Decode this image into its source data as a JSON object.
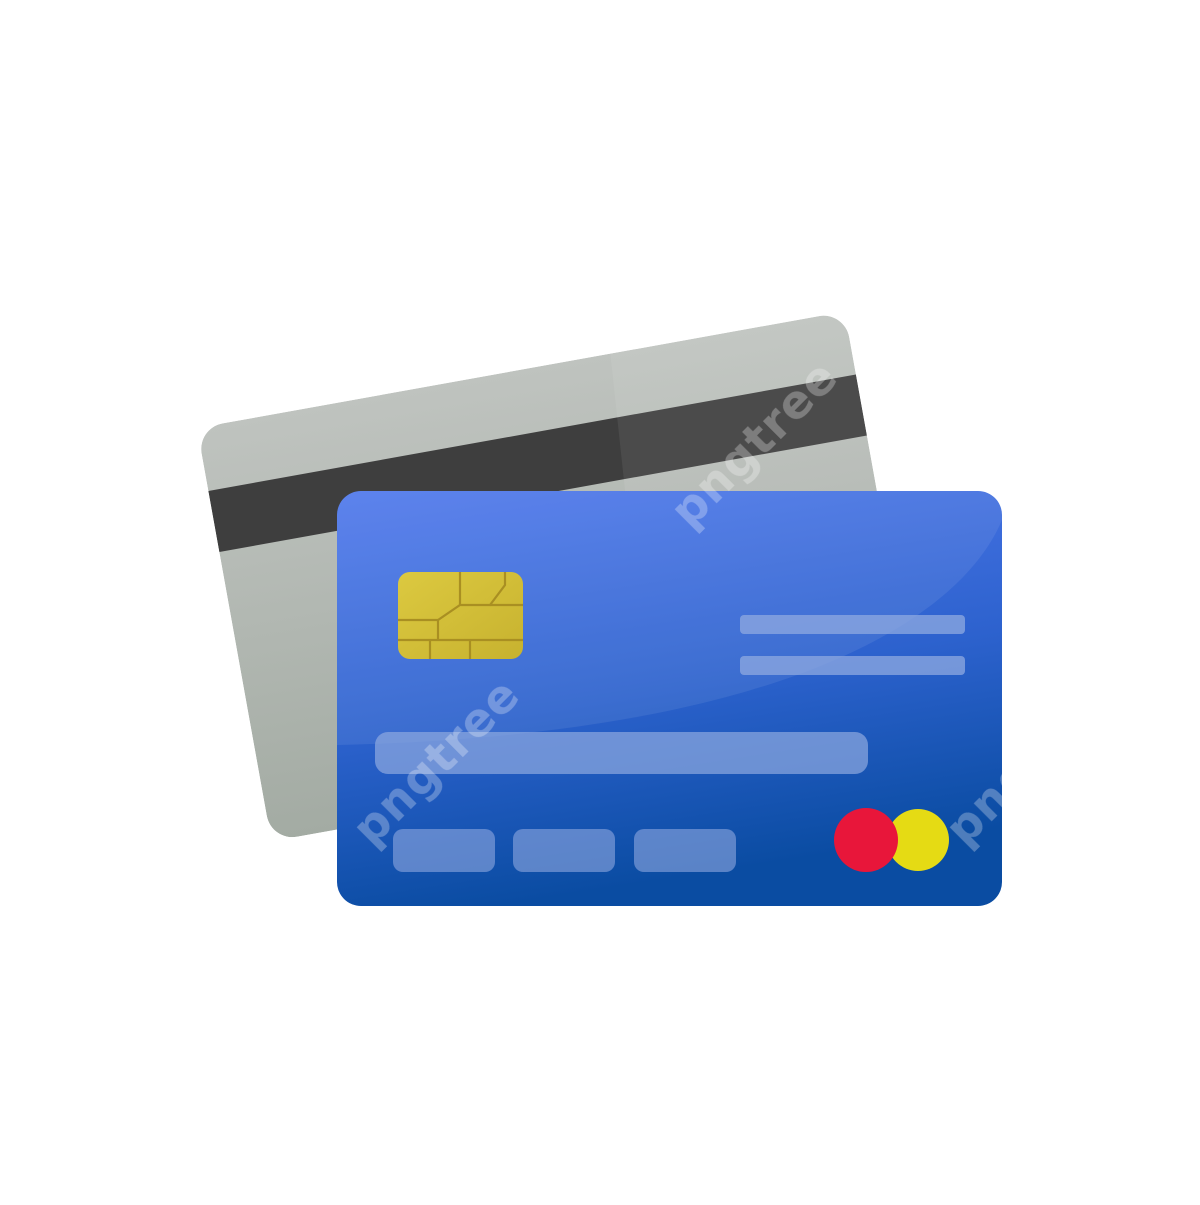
{
  "illustration": {
    "subject": "credit cards",
    "back_card": {
      "body_color": "#B3B8B3",
      "stripe_color": "#3E3E3E"
    },
    "front_card": {
      "top_color": "#4F7AEB",
      "bottom_color": "#0B4DA3",
      "chip_color": "#D2C038",
      "chip_line_color": "#A98F22",
      "circle_left_color": "#E8163A",
      "circle_right_color": "#E5DB14",
      "field_color": "#8FA9E0"
    }
  },
  "watermark": {
    "text": "pngtree",
    "color": "#FFFFFF"
  }
}
